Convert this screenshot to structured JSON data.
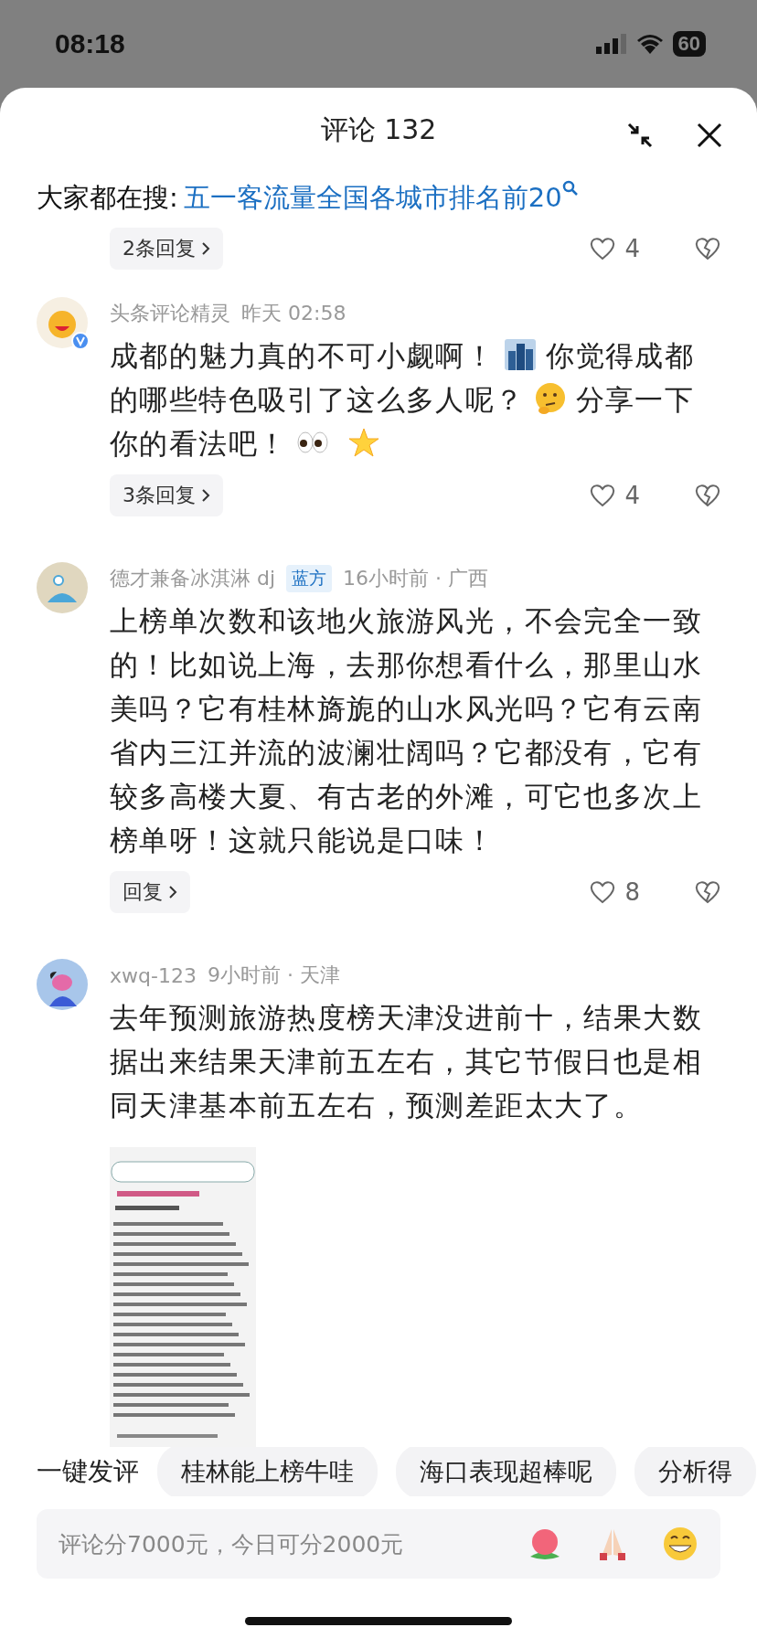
{
  "status_bar": {
    "time": "08:18",
    "battery": "60"
  },
  "header": {
    "title": "评论 132"
  },
  "search": {
    "label": "大家都在搜:",
    "query": "五一客流量全国各城市排名前20"
  },
  "partial_row": {
    "replies": "2条回复",
    "likes": "4"
  },
  "comments": [
    {
      "author": "头条评论精灵",
      "verified": true,
      "meta": "昨天 02:58",
      "body": [
        {
          "kind": "text",
          "text": "成都的魅力真的不可小觑啊！"
        },
        {
          "kind": "city"
        },
        {
          "kind": "text",
          "text": "你觉得成都的哪些特色吸引了这么多人呢？"
        },
        {
          "kind": "thinking"
        },
        {
          "kind": "text",
          "text": "分享一下你的看法吧！"
        },
        {
          "kind": "eyes"
        },
        {
          "kind": "star"
        }
      ],
      "replies": "3条回复",
      "likes": "4",
      "has_picture": false
    },
    {
      "author": "德才兼备冰淇淋 dj",
      "verified": false,
      "badge": "蓝方",
      "meta": "16小时前 · 广西",
      "body": [
        {
          "kind": "text",
          "text": "上榜单次数和该地火旅游风光，不会完全一致的！比如说上海，去那你想看什么，那里山水美吗？它有桂林旖旎的山水风光吗？它有云南省内三江并流的波澜壮阔吗？它都没有，它有较多高楼大夏、有古老的外滩，可它也多次上榜单呀！这就只能说是口味！"
        }
      ],
      "replies": "回复",
      "likes": "8",
      "has_picture": false
    },
    {
      "author": "xwq-123",
      "verified": false,
      "meta": "9小时前 · 天津",
      "body": [
        {
          "kind": "text",
          "text": "去年预测旅游热度榜天津没进前十，结果大数据出来结果天津前五左右，其它节假日也是相同天津基本前五左右，预测差距太大了。"
        }
      ],
      "has_picture": true
    }
  ],
  "quick_replies": {
    "label": "一键发评",
    "chips": [
      "桂林能上榜牛哇",
      "海口表现超棒呢",
      "分析得"
    ]
  },
  "input": {
    "placeholder": "评论分7000元，今日可分2000元"
  }
}
